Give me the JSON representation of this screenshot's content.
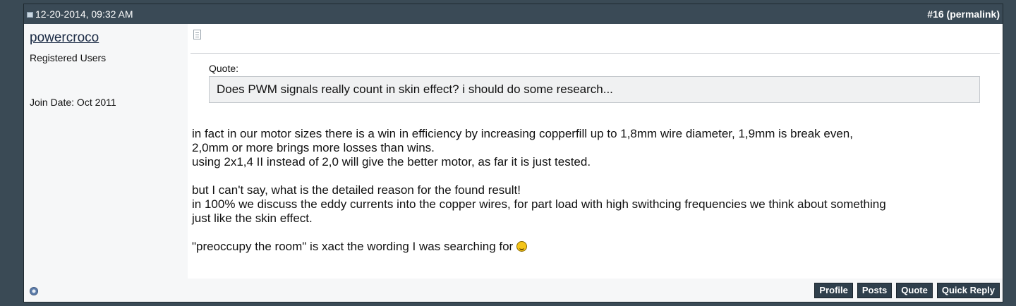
{
  "header": {
    "date": "12-20-2014, 09:32 AM",
    "post_number": "#16",
    "permalink_label": "(permalink)"
  },
  "user": {
    "name": "powercroco",
    "title": "Registered Users",
    "join_date": "Join Date: Oct 2011"
  },
  "quote": {
    "label": "Quote:",
    "text": "Does PWM signals really count in skin effect? i should do some research..."
  },
  "message": {
    "p1_line1": "in fact in our motor sizes there is a win in efficiency by increasing copperfill up to 1,8mm wire diameter, 1,9mm is break even,",
    "p1_line2": "2,0mm or more brings more losses than wins.",
    "p1_line3": "using 2x1,4 II instead of 2,0 will give the better motor, as far it is just tested.",
    "p2_line1": "but I can't say, what is the detailed reason for the found result!",
    "p2_line2": "in 100% we discuss the eddy currents into the copper wires, for part load with high swithcing frequencies we think about something",
    "p2_line3": "just like the skin effect.",
    "p3": "\"preoccupy the room\" is xact the wording I was searching for "
  },
  "buttons": {
    "profile": "Profile",
    "posts": "Posts",
    "quote": "Quote",
    "quick_reply": "Quick Reply"
  },
  "icons": {
    "post_icon": "document-icon",
    "online_status": "offline-status-icon",
    "smiley": "grin-smiley-icon"
  }
}
